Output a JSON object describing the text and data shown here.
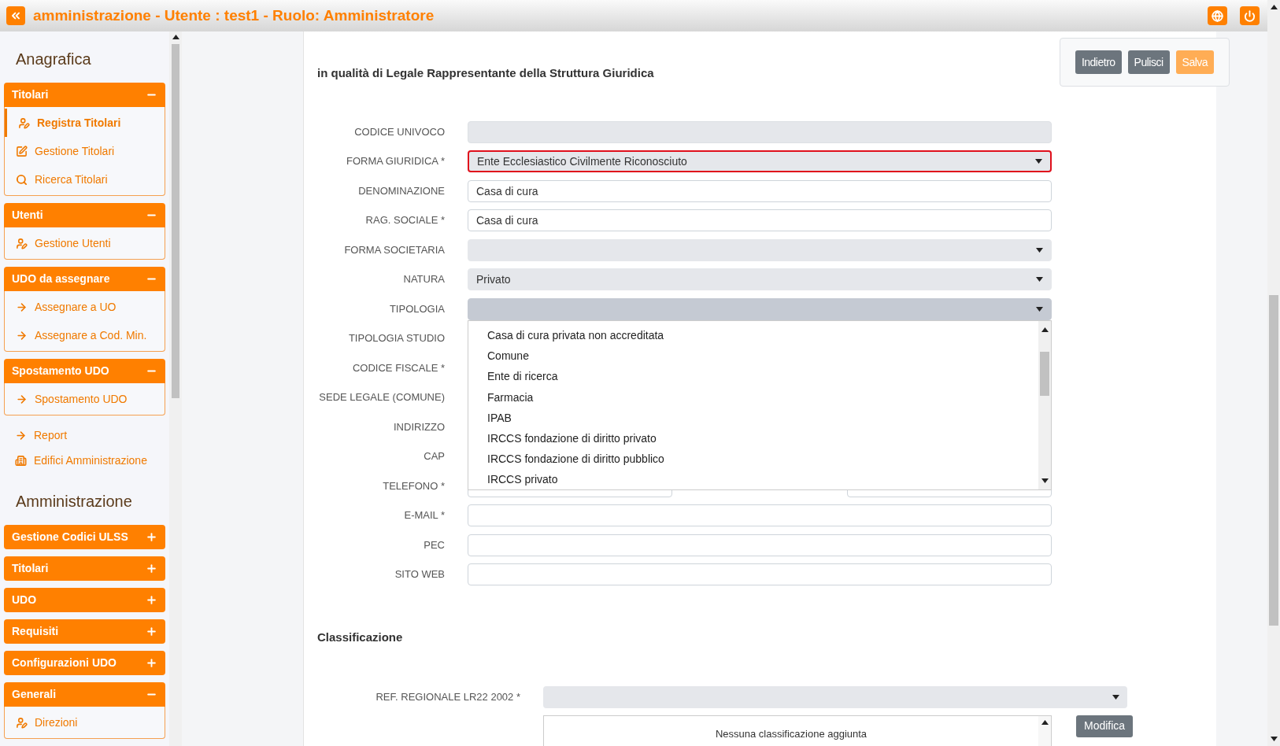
{
  "header": {
    "title": "amministrazione - Utente : test1 - Ruolo: Amministratore"
  },
  "sidebar": [
    {
      "kind": "title",
      "label": "Anagrafica"
    },
    {
      "kind": "group",
      "label": "Titolari",
      "expanded": true,
      "items": [
        {
          "kind": "user",
          "label": "Registra Titolari",
          "selected": true
        },
        {
          "kind": "edit",
          "label": "Gestione Titolari",
          "selected": false
        },
        {
          "kind": "search",
          "label": "Ricerca Titolari",
          "selected": false
        }
      ]
    },
    {
      "kind": "group",
      "label": "Utenti",
      "expanded": true,
      "items": [
        {
          "kind": "user",
          "label": "Gestione Utenti",
          "selected": false
        }
      ]
    },
    {
      "kind": "group",
      "label": "UDO da assegnare",
      "expanded": true,
      "items": [
        {
          "kind": "arrow",
          "label": "Assegnare a UO",
          "selected": false
        },
        {
          "kind": "arrow",
          "label": "Assegnare a Cod. Min.",
          "selected": false
        }
      ]
    },
    {
      "kind": "group",
      "label": "Spostamento UDO",
      "expanded": true,
      "items": [
        {
          "kind": "arrow",
          "label": "Spostamento UDO",
          "selected": false
        }
      ]
    },
    {
      "kind": "link",
      "label": "Report"
    },
    {
      "kind": "link",
      "label": "Edifici Amministrazione"
    },
    {
      "kind": "title",
      "label": "Amministrazione"
    },
    {
      "kind": "group",
      "label": "Gestione Codici ULSS",
      "expanded": false
    },
    {
      "kind": "group",
      "label": "Titolari",
      "expanded": false
    },
    {
      "kind": "group",
      "label": "UDO",
      "expanded": false
    },
    {
      "kind": "group",
      "label": "Requisiti",
      "expanded": false
    },
    {
      "kind": "group",
      "label": "Configurazioni UDO",
      "expanded": false
    },
    {
      "kind": "group",
      "label": "Generali",
      "expanded": true,
      "items": [
        {
          "kind": "user",
          "label": "Direzioni",
          "selected": false
        }
      ]
    }
  ],
  "actions": [
    {
      "label": "Indietro",
      "kind": "secondary",
      "disabled": false
    },
    {
      "label": "Pulisci",
      "kind": "secondary",
      "disabled": false
    },
    {
      "label": "Salva",
      "kind": "primary",
      "disabled": true
    }
  ],
  "heading": "in qualità di Legale Rappresentante della Struttura Giuridica",
  "fields": [
    {
      "label": "CODICE UNIVOCO",
      "kind": "text",
      "disabled": true
    },
    {
      "label": "FORMA GIURIDICA *",
      "kind": "select",
      "value": "Ente Ecclesiastico Civilmente Riconosciuto",
      "invalid": true
    },
    {
      "label": "DENOMINAZIONE",
      "kind": "text",
      "value": "Casa di cura"
    },
    {
      "label": "RAG. SOCIALE *",
      "kind": "text",
      "value": "Casa di cura"
    },
    {
      "label": "FORMA SOCIETARIA",
      "kind": "select"
    },
    {
      "label": "NATURA",
      "kind": "select",
      "value": "Privato"
    },
    {
      "label": "TIPOLOGIA",
      "kind": "select",
      "open": true
    },
    {
      "label": "TIPOLOGIA STUDIO",
      "kind": "covered"
    },
    {
      "label": "CODICE FISCALE *",
      "kind": "covered"
    },
    {
      "label": "SEDE LEGALE (COMUNE)",
      "kind": "covered"
    },
    {
      "label": "INDIRIZZO",
      "kind": "covered"
    },
    {
      "label": "CAP",
      "kind": "covered"
    },
    {
      "label": "TELEFONO *",
      "kind": "pair"
    },
    {
      "label": "E-MAIL *",
      "kind": "text"
    },
    {
      "label": "PEC",
      "kind": "text"
    },
    {
      "label": "SITO WEB",
      "kind": "text"
    }
  ],
  "dropdown": {
    "options": [
      "Casa di cura privata non accreditata",
      "Comune",
      "Ente di ricerca",
      "Farmacia",
      "IPAB",
      "IRCCS fondazione di diritto privato",
      "IRCCS fondazione di diritto pubblico",
      "IRCCS privato"
    ]
  },
  "classification": {
    "title": "Classificazione",
    "label": "REF. REGIONALE LR22 2002 *",
    "empty_text": "Nessuna classificazione aggiunta",
    "button": "Modifica"
  }
}
